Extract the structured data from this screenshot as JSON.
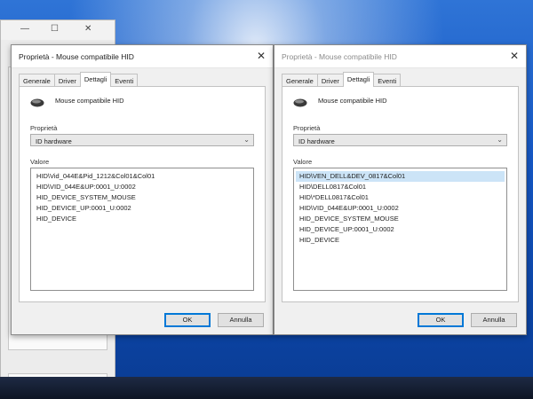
{
  "background_window": {
    "minimize_glyph": "—",
    "maximize_glyph": "☐",
    "close_glyph": "✕",
    "dropdown_chevron": "⌄"
  },
  "dialogs": [
    {
      "title": "Proprietà - Mouse compatibile HID",
      "close_glyph": "✕",
      "tabs": [
        {
          "label": "Generale",
          "active": false
        },
        {
          "label": "Driver",
          "active": false
        },
        {
          "label": "Dettagli",
          "active": true
        },
        {
          "label": "Eventi",
          "active": false
        }
      ],
      "device_icon": "mouse-icon",
      "device_name": "Mouse compatibile HID",
      "property_label": "Proprietà",
      "property_selected": "ID hardware",
      "value_label": "Valore",
      "values": [
        "HID\\Vid_044E&Pid_1212&Col01&Col01",
        "HID\\VID_044E&UP:0001_U:0002",
        "HID_DEVICE_SYSTEM_MOUSE",
        "HID_DEVICE_UP:0001_U:0002",
        "HID_DEVICE"
      ],
      "selected_value_index": -1,
      "ok_label": "OK",
      "cancel_label": "Annulla"
    },
    {
      "title": "Proprietà - Mouse compatibile HID",
      "close_glyph": "✕",
      "tabs": [
        {
          "label": "Generale",
          "active": false
        },
        {
          "label": "Driver",
          "active": false
        },
        {
          "label": "Dettagli",
          "active": true
        },
        {
          "label": "Eventi",
          "active": false
        }
      ],
      "device_icon": "mouse-icon",
      "device_name": "Mouse compatibile HID",
      "property_label": "Proprietà",
      "property_selected": "ID hardware",
      "value_label": "Valore",
      "values": [
        "HID\\VEN_DELL&DEV_0817&Col01",
        "HID\\DELL0817&Col01",
        "HID\\*DELL0817&Col01",
        "HID\\VID_044E&UP:0001_U:0002",
        "HID_DEVICE_SYSTEM_MOUSE",
        "HID_DEVICE_UP:0001_U:0002",
        "HID_DEVICE"
      ],
      "selected_value_index": 0,
      "ok_label": "OK",
      "cancel_label": "Annulla"
    }
  ]
}
